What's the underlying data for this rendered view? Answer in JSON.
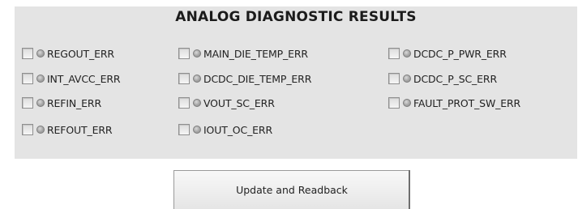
{
  "panel": {
    "title": "ANALOG DIAGNOSTIC RESULTS",
    "items": [
      {
        "label": "REGOUT_ERR"
      },
      {
        "label": "INT_AVCC_ERR"
      },
      {
        "label": "REFIN_ERR"
      },
      {
        "label": "REFOUT_ERR"
      },
      {
        "label": "MAIN_DIE_TEMP_ERR"
      },
      {
        "label": "DCDC_DIE_TEMP_ERR"
      },
      {
        "label": "VOUT_SC_ERR"
      },
      {
        "label": "IOUT_OC_ERR"
      },
      {
        "label": "DCDC_P_PWR_ERR"
      },
      {
        "label": "DCDC_P_SC_ERR"
      },
      {
        "label": "FAULT_PROT_SW_ERR"
      }
    ]
  },
  "actions": {
    "update_label": "Update and Readback"
  },
  "colors": {
    "panel_background": "#e4e4e4",
    "led_off": "#a5a5a5"
  },
  "icons": {
    "status_indicator": "led-indicator-icon",
    "checkbox": "checkbox-icon"
  }
}
